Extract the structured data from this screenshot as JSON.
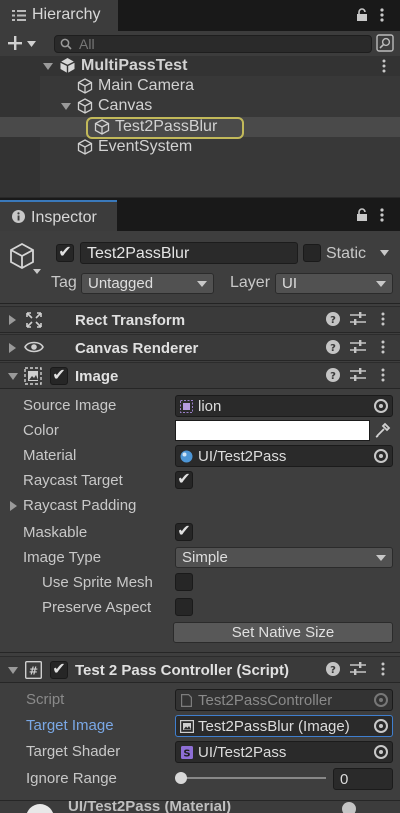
{
  "hierarchy": {
    "tab_label": "Hierarchy",
    "search_placeholder": "All",
    "add_label": "+",
    "items": [
      {
        "label": "MultiPassTest"
      },
      {
        "label": "Main Camera"
      },
      {
        "label": "Canvas"
      },
      {
        "label": "Test2PassBlur"
      },
      {
        "label": "EventSystem"
      }
    ]
  },
  "inspector": {
    "tab_label": "Inspector",
    "gameobject": {
      "name": "Test2PassBlur",
      "static_label": "Static",
      "tag_label": "Tag",
      "tag_value": "Untagged",
      "layer_label": "Layer",
      "layer_value": "UI"
    },
    "components": {
      "rect_transform": {
        "title": "Rect Transform"
      },
      "canvas_renderer": {
        "title": "Canvas Renderer"
      },
      "image": {
        "title": "Image",
        "source_image_label": "Source Image",
        "source_image_value": "lion",
        "color_label": "Color",
        "color_value": "#FFFFFF",
        "material_label": "Material",
        "material_value": "UI/Test2Pass",
        "raycast_target_label": "Raycast Target",
        "raycast_padding_label": "Raycast Padding",
        "maskable_label": "Maskable",
        "image_type_label": "Image Type",
        "image_type_value": "Simple",
        "use_sprite_mesh_label": "Use Sprite Mesh",
        "preserve_aspect_label": "Preserve Aspect",
        "set_native_size_label": "Set Native Size"
      },
      "controller": {
        "title": "Test 2 Pass Controller (Script)",
        "script_label": "Script",
        "script_value": "Test2PassController",
        "target_image_label": "Target Image",
        "target_image_value": "Test2PassBlur (Image)",
        "target_shader_label": "Target Shader",
        "target_shader_value": "UI/Test2Pass",
        "ignore_range_label": "Ignore Range",
        "ignore_range_value": "0"
      },
      "material_preview": {
        "title": "UI/Test2Pass (Material)"
      }
    }
  },
  "colors": {
    "selection_outline": "#C2B95A",
    "focus_blue": "#3F7FCF",
    "label_blue": "#7AA8E6"
  }
}
